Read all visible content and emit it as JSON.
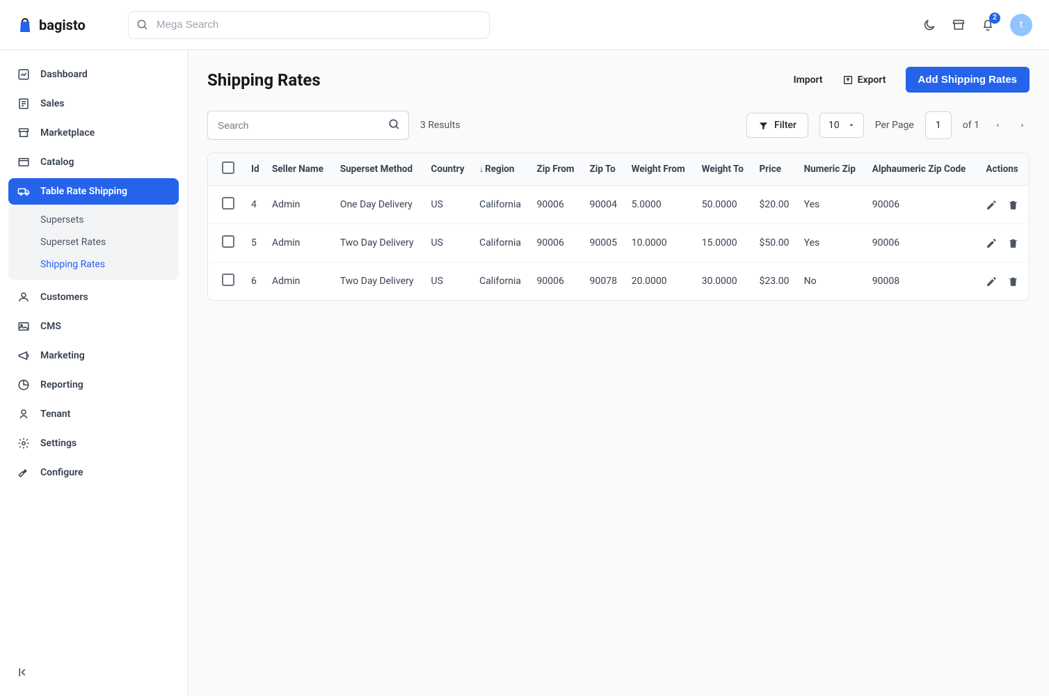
{
  "brand": "bagisto",
  "search": {
    "placeholder": "Mega Search"
  },
  "notifications": {
    "count": "2"
  },
  "avatar_initial": "t",
  "sidebar": {
    "items": [
      {
        "label": "Dashboard"
      },
      {
        "label": "Sales"
      },
      {
        "label": "Marketplace"
      },
      {
        "label": "Catalog"
      },
      {
        "label": "Table Rate Shipping"
      },
      {
        "label": "Customers"
      },
      {
        "label": "CMS"
      },
      {
        "label": "Marketing"
      },
      {
        "label": "Reporting"
      },
      {
        "label": "Tenant"
      },
      {
        "label": "Settings"
      },
      {
        "label": "Configure"
      }
    ],
    "sub": [
      {
        "label": "Supersets"
      },
      {
        "label": "Superset Rates"
      },
      {
        "label": "Shipping Rates"
      }
    ]
  },
  "page": {
    "title": "Shipping Rates",
    "import": "Import",
    "export": "Export",
    "add_button": "Add Shipping Rates"
  },
  "toolbar": {
    "search_placeholder": "Search",
    "results": "3 Results",
    "filter": "Filter",
    "per_page_value": "10",
    "per_page_label": "Per Page",
    "page_current": "1",
    "of": "of",
    "page_total": "1"
  },
  "table": {
    "headers": {
      "id": "Id",
      "seller": "Seller Name",
      "method": "Superset Method",
      "country": "Country",
      "region": "Region",
      "zip_from": "Zip From",
      "zip_to": "Zip To",
      "w_from": "Weight From",
      "w_to": "Weight To",
      "price": "Price",
      "num_zip": "Numeric Zip",
      "alpha_zip": "Alphaumeric Zip Code",
      "actions": "Actions"
    },
    "rows": [
      {
        "id": "4",
        "seller": "Admin",
        "method": "One Day Delivery",
        "country": "US",
        "region": "California",
        "zip_from": "90006",
        "zip_to": "90004",
        "w_from": "5.0000",
        "w_to": "50.0000",
        "price": "$20.00",
        "num_zip": "Yes",
        "alpha_zip": "90006"
      },
      {
        "id": "5",
        "seller": "Admin",
        "method": "Two Day Delivery",
        "country": "US",
        "region": "California",
        "zip_from": "90006",
        "zip_to": "90005",
        "w_from": "10.0000",
        "w_to": "15.0000",
        "price": "$50.00",
        "num_zip": "Yes",
        "alpha_zip": "90006"
      },
      {
        "id": "6",
        "seller": "Admin",
        "method": "Two Day Delivery",
        "country": "US",
        "region": "California",
        "zip_from": "90006",
        "zip_to": "90078",
        "w_from": "20.0000",
        "w_to": "30.0000",
        "price": "$23.00",
        "num_zip": "No",
        "alpha_zip": "90008"
      }
    ]
  }
}
